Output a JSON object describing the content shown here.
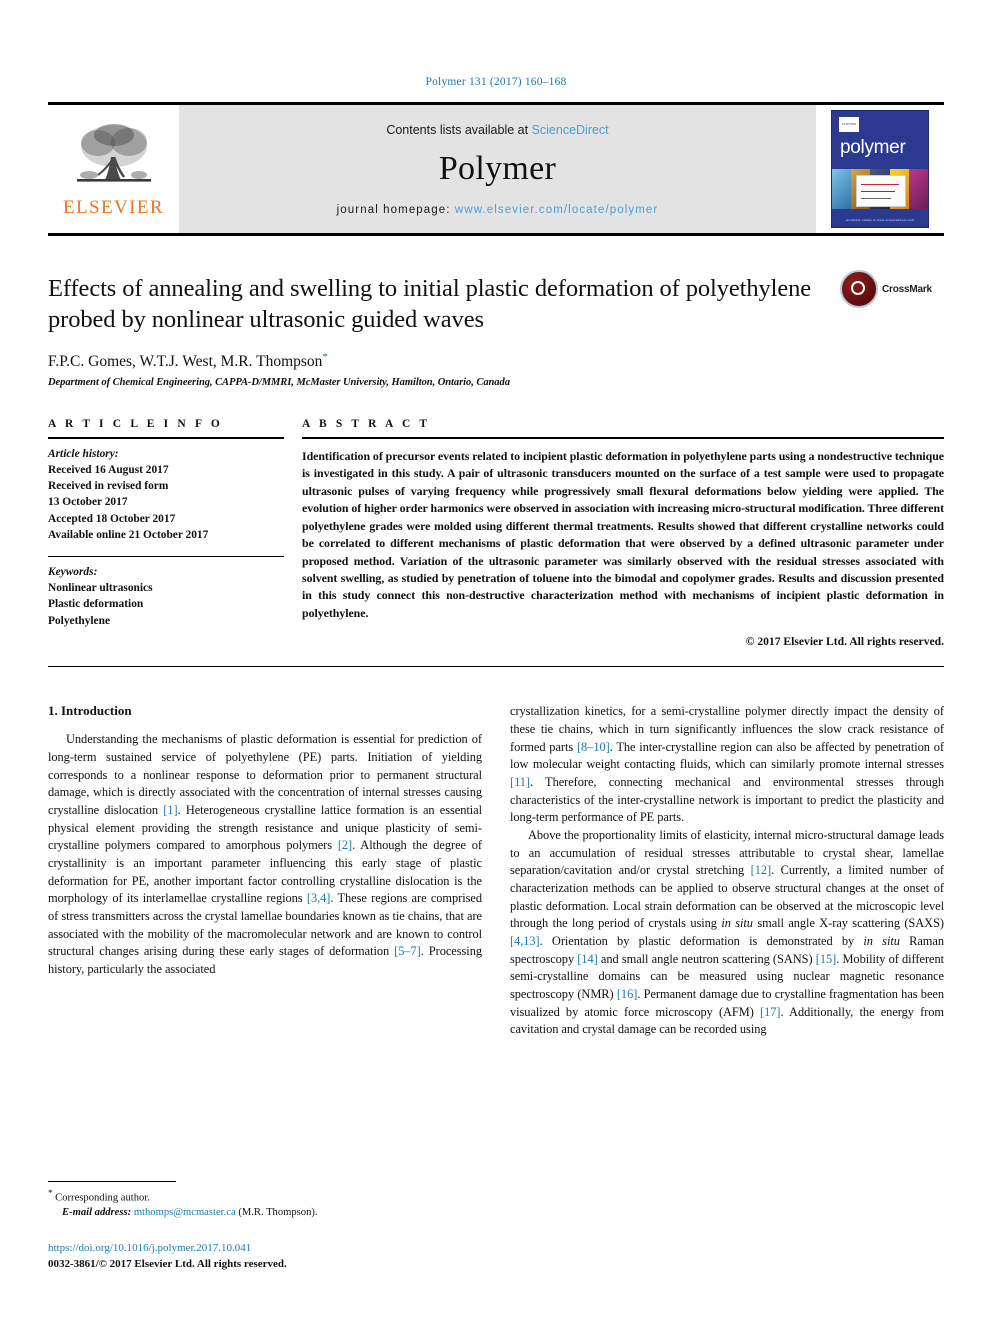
{
  "running_head": "Polymer 131 (2017) 160–168",
  "masthead": {
    "publisher_logo_text": "ELSEVIER",
    "contents_prefix": "Contents lists available at ",
    "contents_link": "ScienceDirect",
    "journal_name": "Polymer",
    "homepage_prefix": "journal homepage: ",
    "homepage_url": "www.elsevier.com/locate/polymer",
    "cover_title": "polymer",
    "cover_badge": "ELSEVIER",
    "cover_footer": "Available online at www.sciencedirect.com"
  },
  "article": {
    "title": "Effects of annealing and swelling to initial plastic deformation of polyethylene probed by nonlinear ultrasonic guided waves",
    "authors": "F.P.C. Gomes, W.T.J. West, M.R. Thompson",
    "corresponding_marker": "*",
    "affiliation": "Department of Chemical Engineering, CAPPA-D/MMRI, McMaster University, Hamilton, Ontario, Canada",
    "crossmark_label": "CrossMark"
  },
  "article_info": {
    "heading": "A R T I C L E  I N F O",
    "history_label": "Article history:",
    "history": [
      "Received 16 August 2017",
      "Received in revised form",
      "13 October 2017",
      "Accepted 18 October 2017",
      "Available online 21 October 2017"
    ],
    "keywords_label": "Keywords:",
    "keywords": [
      "Nonlinear ultrasonics",
      "Plastic deformation",
      "Polyethylene"
    ]
  },
  "abstract": {
    "heading": "A B S T R A C T",
    "text": "Identification of precursor events related to incipient plastic deformation in polyethylene parts using a nondestructive technique is investigated in this study. A pair of ultrasonic transducers mounted on the surface of a test sample were used to propagate ultrasonic pulses of varying frequency while progressively small flexural deformations below yielding were applied. The evolution of higher order harmonics were observed in association with increasing micro-structural modification. Three different polyethylene grades were molded using different thermal treatments. Results showed that different crystalline networks could be correlated to different mechanisms of plastic deformation that were observed by a defined ultrasonic parameter under proposed method. Variation of the ultrasonic parameter was similarly observed with the residual stresses associated with solvent swelling, as studied by penetration of toluene into the bimodal and copolymer grades. Results and discussion presented in this study connect this non-destructive characterization method with mechanisms of incipient plastic deformation in polyethylene.",
    "copyright": "© 2017 Elsevier Ltd. All rights reserved."
  },
  "body": {
    "section_number_title": "1. Introduction",
    "left_paragraph": "Understanding the mechanisms of plastic deformation is essential for prediction of long-term sustained service of polyethylene (PE) parts. Initiation of yielding corresponds to a nonlinear response to deformation prior to permanent structural damage, which is directly associated with the concentration of internal stresses causing crystalline dislocation [1]. Heterogeneous crystalline lattice formation is an essential physical element providing the strength resistance and unique plasticity of semi-crystalline polymers compared to amorphous polymers [2]. Although the degree of crystallinity is an important parameter influencing this early stage of plastic deformation for PE, another important factor controlling crystalline dislocation is the morphology of its interlamellae crystalline regions [3,4]. These regions are comprised of stress transmitters across the crystal lamellae boundaries known as tie chains, that are associated with the mobility of the macromolecular network and are known to control structural changes arising during these early stages of deformation [5–7]. Processing history, particularly the associated",
    "right_paragraph_1": "crystallization kinetics, for a semi-crystalline polymer directly impact the density of these tie chains, which in turn significantly influences the slow crack resistance of formed parts [8–10]. The inter-crystalline region can also be affected by penetration of low molecular weight contacting fluids, which can similarly promote internal stresses [11]. Therefore, connecting mechanical and environmental stresses through characteristics of the inter-crystalline network is important to predict the plasticity and long-term performance of PE parts.",
    "right_paragraph_2": "Above the proportionality limits of elasticity, internal micro-structural damage leads to an accumulation of residual stresses attributable to crystal shear, lamellae separation/cavitation and/or crystal stretching [12]. Currently, a limited number of characterization methods can be applied to observe structural changes at the onset of plastic deformation. Local strain deformation can be observed at the microscopic level through the long period of crystals using in situ small angle X-ray scattering (SAXS) [4,13]. Orientation by plastic deformation is demonstrated by in situ Raman spectroscopy [14] and small angle neutron scattering (SANS) [15]. Mobility of different semi-crystalline domains can be measured using nuclear magnetic resonance spectroscopy (NMR) [16]. Permanent damage due to crystalline fragmentation has been visualized by atomic force microscopy (AFM) [17]. Additionally, the energy from cavitation and crystal damage can be recorded using"
  },
  "footnotes": {
    "corresponding_marker": "*",
    "corresponding_text": "Corresponding author.",
    "email_label": "E-mail address:",
    "email": "mthomps@mcmaster.ca",
    "email_suffix": "(M.R. Thompson).",
    "doi": "https://doi.org/10.1016/j.polymer.2017.10.041",
    "issn_line": "0032-3861/© 2017 Elsevier Ltd. All rights reserved."
  },
  "colors": {
    "link": "#1a7aab",
    "science_direct": "#4a9fd5",
    "elsevier_orange": "#e87722",
    "cover_blue": "#2b3990"
  }
}
